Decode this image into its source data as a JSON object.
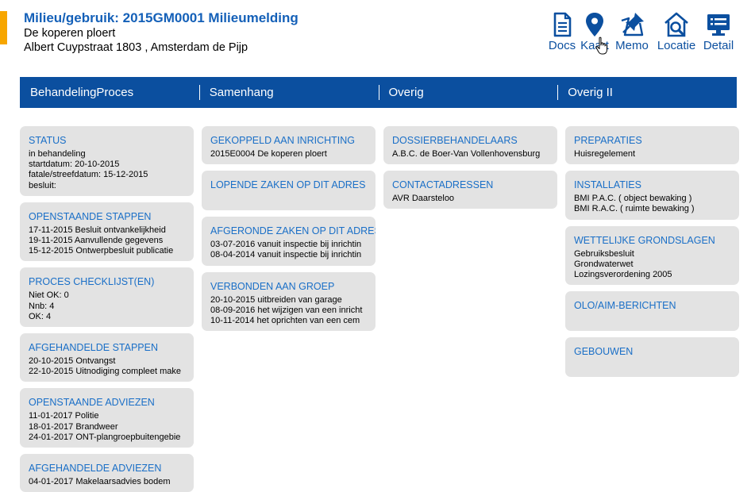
{
  "header": {
    "title": "Milieu/gebruik: 2015GM0001 Milieumelding",
    "subtitle": "De koperen ploert",
    "address": "Albert Cuypstraat 1803 , Amsterdam de Pijp"
  },
  "toolbar": {
    "docs": "Docs",
    "kaart": "Kaart",
    "memo": "Memo",
    "locatie": "Locatie",
    "detail": "Detail"
  },
  "tabs": [
    "BehandelingProces",
    "Samenhang",
    "Overig",
    "Overig II"
  ],
  "columns": {
    "col1": [
      {
        "title": "STATUS",
        "lines": [
          "in behandeling",
          "startdatum: 20-10-2015",
          "fatale/streefdatum: 15-12-2015",
          "besluit:"
        ]
      },
      {
        "title": "OPENSTAANDE STAPPEN",
        "lines": [
          "17-11-2015 Besluit ontvankelijkheid",
          "19-11-2015 Aanvullende gegevens",
          "15-12-2015 Ontwerpbesluit publicatie"
        ]
      },
      {
        "title": "PROCES CHECKLIJST(EN)",
        "lines": [
          "Niet OK: 0",
          "Nnb: 4",
          "OK: 4"
        ]
      },
      {
        "title": "AFGEHANDELDE STAPPEN",
        "lines": [
          "20-10-2015 Ontvangst",
          "22-10-2015 Uitnodiging compleet make"
        ]
      },
      {
        "title": "OPENSTAANDE ADVIEZEN",
        "lines": [
          "11-01-2017 Politie",
          "18-01-2017 Brandweer",
          "24-01-2017 ONT-plangroepbuitengebie"
        ]
      },
      {
        "title": "AFGEHANDELDE ADVIEZEN",
        "lines": [
          "04-01-2017 Makelaarsadvies bodem"
        ]
      }
    ],
    "col2": [
      {
        "title": "GEKOPPELD AAN INRICHTING",
        "lines": [
          "2015E0004 De koperen ploert"
        ]
      },
      {
        "title": "LOPENDE ZAKEN OP DIT ADRES",
        "lines": []
      },
      {
        "title": "AFGERONDE ZAKEN OP DIT ADRES",
        "lines": [
          "03-07-2016 vanuit inspectie bij inrichtin",
          "08-04-2014 vanuit inspectie bij inrichtin"
        ]
      },
      {
        "title": "VERBONDEN AAN GROEP",
        "lines": [
          "20-10-2015 uitbreiden van garage",
          "08-09-2016 het wijzigen van een inricht",
          "10-11-2014 het oprichten van een cem"
        ]
      }
    ],
    "col3": [
      {
        "title": "DOSSIERBEHANDELAARS",
        "lines": [
          "A.B.C. de Boer-Van Vollenhovensburg"
        ]
      },
      {
        "title": "CONTACTADRESSEN",
        "lines": [
          "AVR Daarsteloo"
        ]
      }
    ],
    "col4": [
      {
        "title": "PREPARATIES",
        "lines": [
          "Huisregelement"
        ]
      },
      {
        "title": "INSTALLATIES",
        "lines": [
          "BMI P.A.C. ( object bewaking )",
          "BMI R.A.C. ( ruimte bewaking )"
        ]
      },
      {
        "title": "WETTELIJKE GRONDSLAGEN",
        "lines": [
          "Gebruiksbesluit",
          "Grondwaterwet",
          "Lozingsverordening 2005"
        ]
      },
      {
        "title": "OLO/AIM-BERICHTEN",
        "lines": []
      },
      {
        "title": "GEBOUWEN",
        "lines": []
      }
    ]
  },
  "colors": {
    "tab_bar": "#0b4f9f",
    "card_title": "#1a6fc7",
    "card_bg": "#e3e3e3",
    "accent": "#f7a600"
  }
}
